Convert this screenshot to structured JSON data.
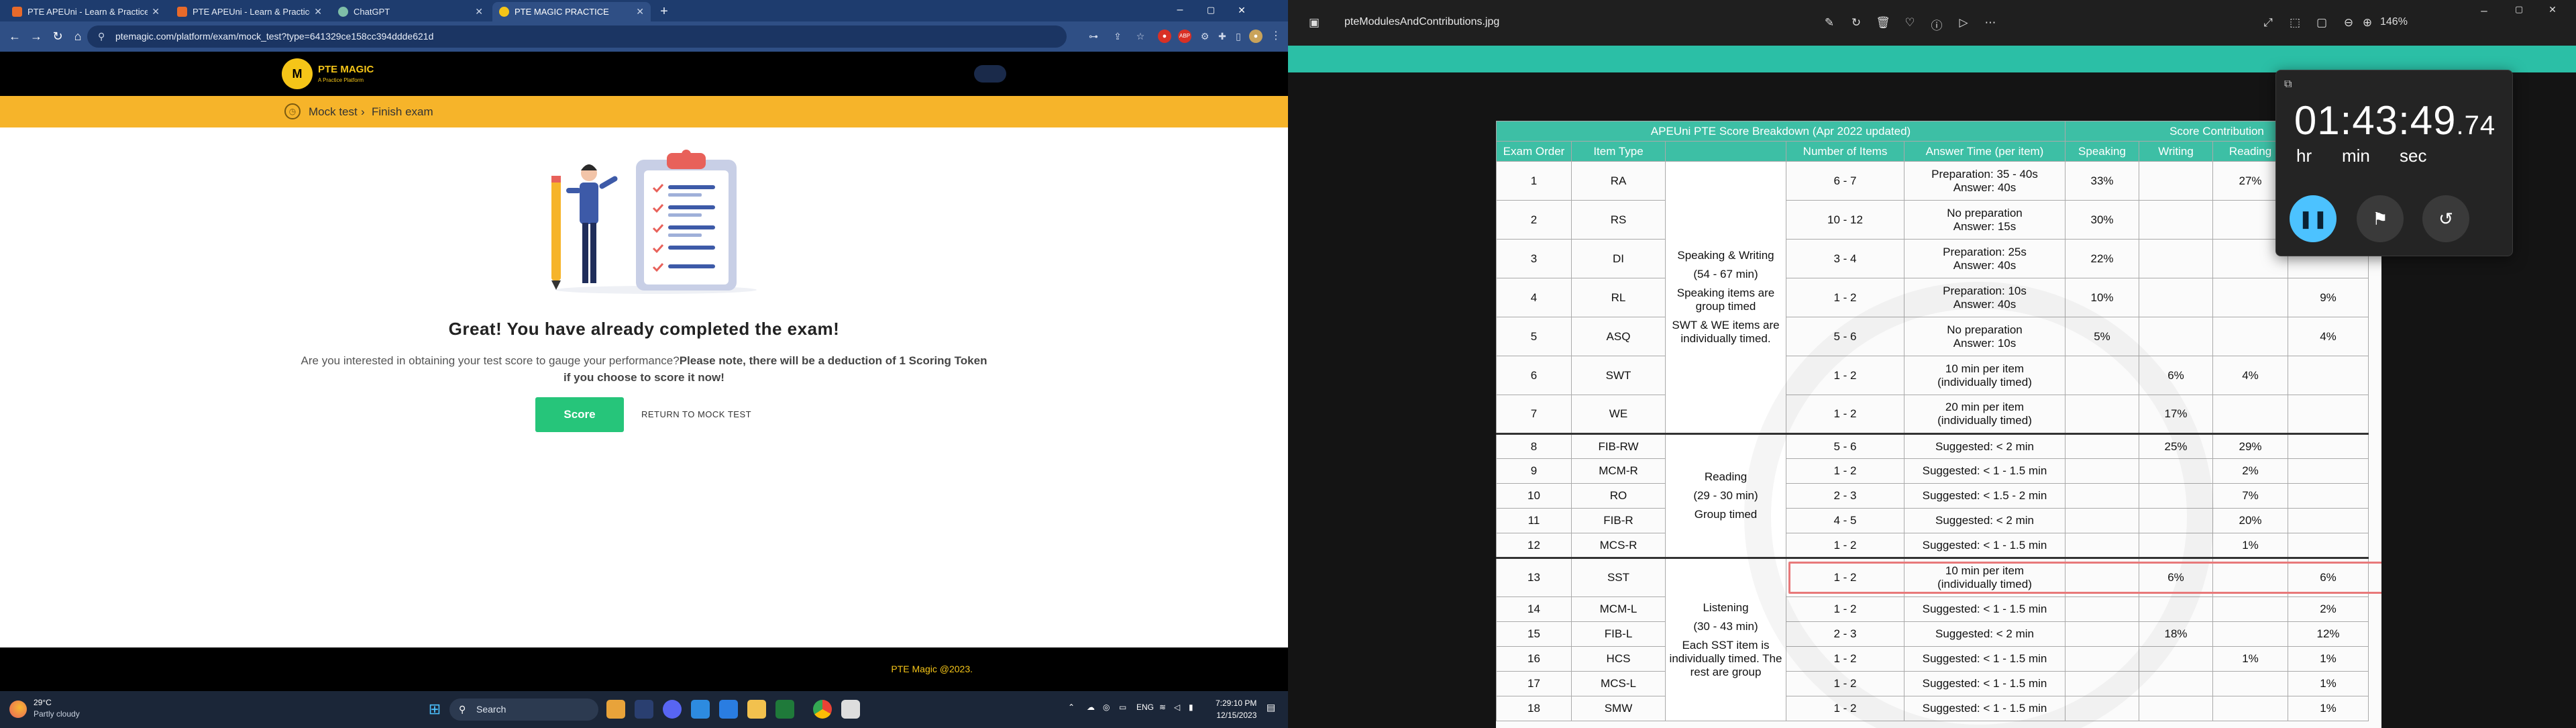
{
  "browser": {
    "tabs": [
      {
        "label": "PTE APEUni - Learn & Practice PT",
        "color": "#e86a2a"
      },
      {
        "label": "PTE APEUni - Learn & Practice P",
        "color": "#e86a2a"
      },
      {
        "label": "ChatGPT",
        "color": "#7fbfa8"
      },
      {
        "label": "PTE MAGIC PRACTICE",
        "color": "#f5c518"
      }
    ],
    "new_tab": "+",
    "url": "ptemagic.com/platform/exam/mock_test?type=641329ce158cc394ddde621d",
    "window_controls": {
      "minimize": "–",
      "maximize": "▢",
      "close": "✕"
    }
  },
  "site": {
    "logo_mark": "M",
    "logo_name": "PTE MAGIC",
    "logo_tagline": "A Practice Platform",
    "breadcrumb": {
      "item1": "Mock test",
      "sep": "›",
      "item2": "Finish exam"
    },
    "headline": "Great! You have already completed the exam!",
    "message_plain": "Are you interested in obtaining your test score to gauge your performance?",
    "message_bold": "Please note, there will be a deduction of 1 Scoring Token",
    "message_line2": "if you choose to score it now!",
    "score_button": "Score",
    "return_link": "RETURN TO MOCK TEST",
    "footer": "PTE Magic @2023."
  },
  "taskbar": {
    "weather_temp": "29°C",
    "weather_desc": "Partly cloudy",
    "search_placeholder": "Search",
    "lang": "ENG",
    "time": "7:29:10 PM",
    "date": "12/15/2023"
  },
  "viewer": {
    "file_name": "pteModulesAndContributions.jpg",
    "zoom": "146%",
    "table": {
      "title": "APEUni PTE Score Breakdown  (Apr 2022 updated)",
      "contribution_header": "Score Contribution",
      "columns": [
        "Exam Order",
        "Item Type",
        "",
        "Number of Items",
        "Answer Time (per item)",
        "Speaking",
        "Writing",
        "Reading",
        ""
      ],
      "rows": [
        {
          "order": "1",
          "type": "RA",
          "count": "6 - 7",
          "time": "Preparation: 35 - 40s\nAnswer: 40s",
          "speaking": "33%",
          "writing": "",
          "reading": "27%",
          "listening": ""
        },
        {
          "order": "2",
          "type": "RS",
          "count": "10 - 12",
          "time": "No preparation\nAnswer: 15s",
          "speaking": "30%",
          "writing": "",
          "reading": "",
          "listening": ""
        },
        {
          "order": "3",
          "type": "DI",
          "count": "3 - 4",
          "time": "Preparation: 25s\nAnswer: 40s",
          "speaking": "22%",
          "writing": "",
          "reading": "",
          "listening": ""
        },
        {
          "order": "4",
          "type": "RL",
          "count": "1 - 2",
          "time": "Preparation: 10s\nAnswer: 40s",
          "speaking": "10%",
          "writing": "",
          "reading": "",
          "listening": "9%"
        },
        {
          "order": "5",
          "type": "ASQ",
          "count": "5 - 6",
          "time": "No preparation\nAnswer: 10s",
          "speaking": "5%",
          "writing": "",
          "reading": "",
          "listening": "4%"
        },
        {
          "order": "6",
          "type": "SWT",
          "count": "1 - 2",
          "time": "10 min per item\n(individually timed)",
          "speaking": "",
          "writing": "6%",
          "reading": "4%",
          "listening": ""
        },
        {
          "order": "7",
          "type": "WE",
          "count": "1 - 2",
          "time": "20 min per item\n(individually timed)",
          "speaking": "",
          "writing": "17%",
          "reading": "",
          "listening": ""
        },
        {
          "order": "8",
          "type": "FIB-RW",
          "count": "5 - 6",
          "time": "Suggested: < 2 min",
          "speaking": "",
          "writing": "25%",
          "reading": "29%",
          "listening": ""
        },
        {
          "order": "9",
          "type": "MCM-R",
          "count": "1 - 2",
          "time": "Suggested: < 1 - 1.5 min",
          "speaking": "",
          "writing": "",
          "reading": "2%",
          "listening": ""
        },
        {
          "order": "10",
          "type": "RO",
          "count": "2 - 3",
          "time": "Suggested: < 1.5 - 2 min",
          "speaking": "",
          "writing": "",
          "reading": "7%",
          "listening": ""
        },
        {
          "order": "11",
          "type": "FIB-R",
          "count": "4 - 5",
          "time": "Suggested: < 2 min",
          "speaking": "",
          "writing": "",
          "reading": "20%",
          "listening": ""
        },
        {
          "order": "12",
          "type": "MCS-R",
          "count": "1 - 2",
          "time": "Suggested: < 1 - 1.5 min",
          "speaking": "",
          "writing": "",
          "reading": "1%",
          "listening": ""
        },
        {
          "order": "13",
          "type": "SST",
          "count": "1 - 2",
          "time": "10 min per item\n(individually timed)",
          "speaking": "",
          "writing": "6%",
          "reading": "",
          "listening": "6%"
        },
        {
          "order": "14",
          "type": "MCM-L",
          "count": "1 - 2",
          "time": "Suggested: < 1 - 1.5 min",
          "speaking": "",
          "writing": "",
          "reading": "",
          "listening": "2%"
        },
        {
          "order": "15",
          "type": "FIB-L",
          "count": "2 - 3",
          "time": "Suggested: < 2 min",
          "speaking": "",
          "writing": "18%",
          "reading": "",
          "listening": "12%"
        },
        {
          "order": "16",
          "type": "HCS",
          "count": "1 - 2",
          "time": "Suggested: < 1 - 1.5 min",
          "speaking": "",
          "writing": "",
          "reading": "1%",
          "listening": "1%"
        },
        {
          "order": "17",
          "type": "MCS-L",
          "count": "1 - 2",
          "time": "Suggested: < 1 - 1.5 min",
          "speaking": "",
          "writing": "",
          "reading": "",
          "listening": "1%"
        },
        {
          "order": "18",
          "type": "SMW",
          "count": "1 - 2",
          "time": "Suggested: < 1 - 1.5 min",
          "speaking": "",
          "writing": "",
          "reading": "",
          "listening": "1%"
        }
      ],
      "groups": {
        "speaking_writing": [
          "Speaking & Writing",
          "(54 - 67 min)",
          "Speaking items are group timed",
          "SWT & WE items are individually timed."
        ],
        "reading": [
          "Reading",
          "(29 - 30 min)",
          "Group timed"
        ],
        "listening": [
          "Listening",
          "(30 - 43 min)",
          "Each SST item is individually timed. The rest are group"
        ]
      }
    }
  },
  "timer": {
    "hours": "01",
    "minutes": "43",
    "seconds": "49",
    "hundredths": ".74",
    "label_hr": "hr",
    "label_min": "min",
    "label_sec": "sec",
    "sep": ":"
  },
  "colors": {
    "accent_yellow": "#f6b42a",
    "score_green": "#26c57a",
    "table_teal": "#3dbfa5",
    "highlight_red": "#e8797a",
    "timer_play_blue": "#4cc2ff"
  }
}
